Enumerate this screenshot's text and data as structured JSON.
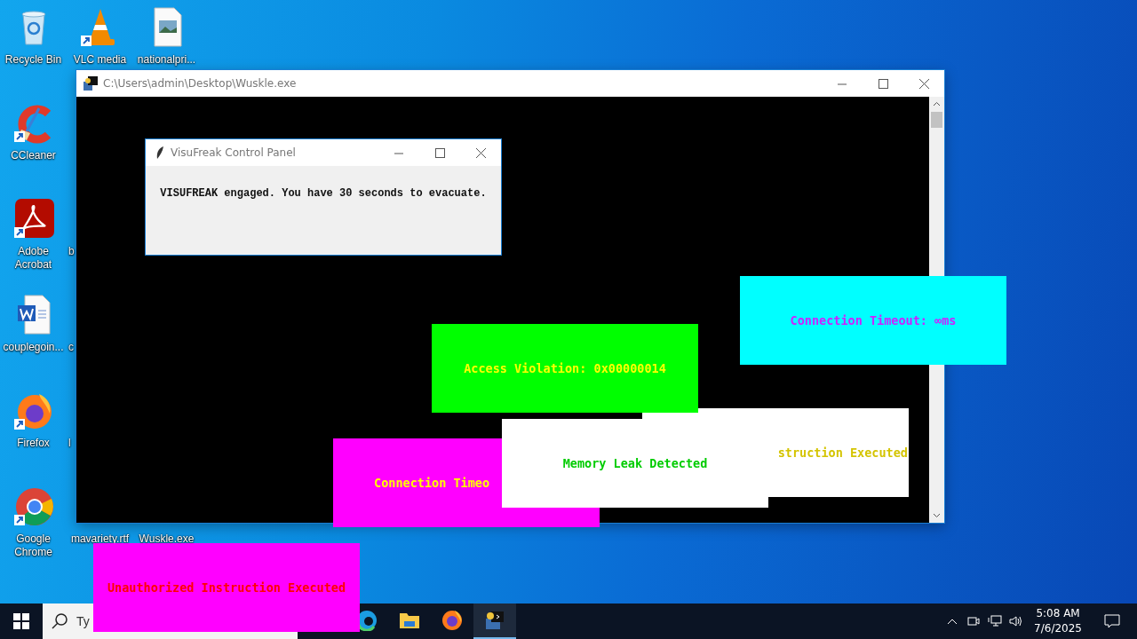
{
  "desktop_icons": [
    {
      "label": "Recycle Bin",
      "kind": "recycle",
      "shortcut": false
    },
    {
      "label": "VLC media",
      "kind": "vlc",
      "shortcut": true
    },
    {
      "label": "nationalpri...",
      "kind": "image",
      "shortcut": false
    },
    {
      "label": "CCleaner",
      "kind": "ccleaner",
      "shortcut": true
    },
    {
      "label": "Adobe Acrobat",
      "kind": "acrobat",
      "shortcut": true
    },
    {
      "label": "b",
      "kind": "covered"
    },
    {
      "label": "couplegoin...",
      "kind": "word",
      "shortcut": false
    },
    {
      "label": "c",
      "kind": "covered"
    },
    {
      "label": "Firefox",
      "kind": "firefox",
      "shortcut": true
    },
    {
      "label": "l",
      "kind": "covered"
    },
    {
      "label": "Google Chrome",
      "kind": "chrome",
      "shortcut": true
    },
    {
      "label": "mavariety.rtf",
      "kind": "covered"
    },
    {
      "label": "Wuskle.exe",
      "kind": "covered"
    }
  ],
  "console_window": {
    "title": "C:\\Users\\admin\\Desktop\\Wuskle.exe"
  },
  "control_panel": {
    "title": "VisuFreak Control Panel",
    "message": "VISUFREAK engaged. You have 30 seconds to evacuate."
  },
  "error_popups": [
    {
      "color": "#ffffff",
      "message": {
        "text": "struction Executed",
        "color": "#d4c400"
      }
    },
    {
      "color": "#00ff00",
      "message": {
        "text": "Access Violation: 0x00000014",
        "color": "#ffff00"
      }
    },
    {
      "color": "#ff00ff",
      "message": {
        "text": "Connection Timeo",
        "color": "#ffff00"
      }
    },
    {
      "color": "#ffffff",
      "message": {
        "text": "Memory Leak Detected",
        "color": "#00cc00"
      }
    },
    {
      "color": "#00ffff",
      "message": {
        "text": "Connection Timeout: ∞ms",
        "color": "#cc22ff"
      }
    },
    {
      "color": "#ff00ff",
      "message": {
        "text": "Unauthorized Instruction Executed",
        "color": "#ff0000"
      }
    }
  ],
  "taskbar": {
    "search": {
      "placeholder": "Ty"
    },
    "apps": [
      {
        "kind": "edge",
        "active": false
      },
      {
        "kind": "explorer",
        "active": false
      },
      {
        "kind": "firefox",
        "active": false
      },
      {
        "kind": "python",
        "active": true
      }
    ],
    "clock": {
      "time": "5:08 AM",
      "date": "7/6/2025"
    }
  }
}
